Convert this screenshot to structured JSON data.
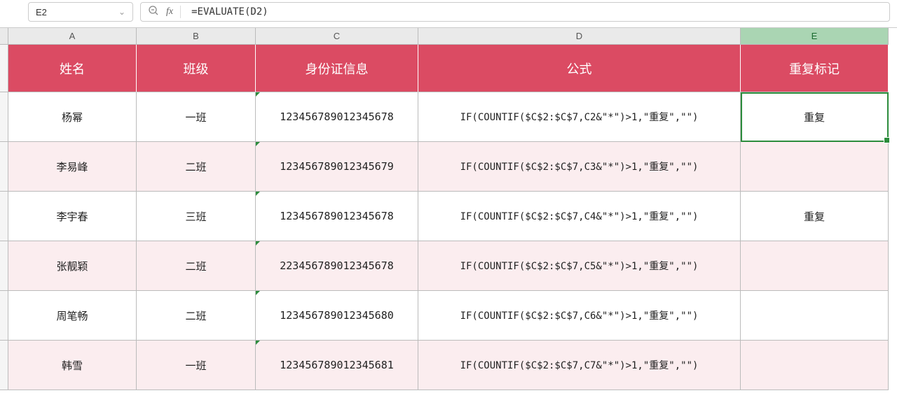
{
  "nameBox": "E2",
  "formula": "=EVALUATE(D2)",
  "fxLabel": "fx",
  "columns": [
    "A",
    "B",
    "C",
    "D",
    "E"
  ],
  "selectedColumn": "E",
  "headers": {
    "a": "姓名",
    "b": "班级",
    "c": "身份证信息",
    "d": "公式",
    "e": "重复标记"
  },
  "rows": [
    {
      "name": "杨幂",
      "class": "一班",
      "id": "123456789012345678",
      "formula": "IF(COUNTIF($C$2:$C$7,C2&\"*\")>1,\"重复\",\"\")",
      "mark": "重复"
    },
    {
      "name": "李易峰",
      "class": "二班",
      "id": "123456789012345679",
      "formula": "IF(COUNTIF($C$2:$C$7,C3&\"*\")>1,\"重复\",\"\")",
      "mark": ""
    },
    {
      "name": "李宇春",
      "class": "三班",
      "id": "123456789012345678",
      "formula": "IF(COUNTIF($C$2:$C$7,C4&\"*\")>1,\"重复\",\"\")",
      "mark": "重复"
    },
    {
      "name": "张靓颖",
      "class": "二班",
      "id": "223456789012345678",
      "formula": "IF(COUNTIF($C$2:$C$7,C5&\"*\")>1,\"重复\",\"\")",
      "mark": ""
    },
    {
      "name": "周笔畅",
      "class": "二班",
      "id": "123456789012345680",
      "formula": "IF(COUNTIF($C$2:$C$7,C6&\"*\")>1,\"重复\",\"\")",
      "mark": ""
    },
    {
      "name": "韩雪",
      "class": "一班",
      "id": "123456789012345681",
      "formula": "IF(COUNTIF($C$2:$C$7,C7&\"*\")>1,\"重复\",\"\")",
      "mark": ""
    }
  ]
}
